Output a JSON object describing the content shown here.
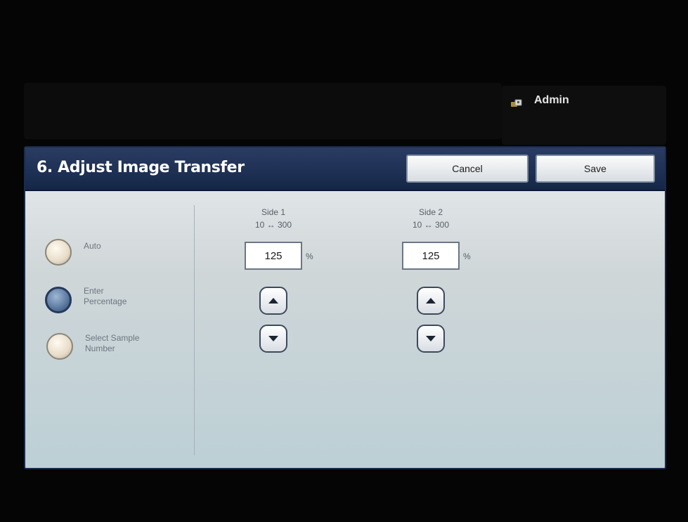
{
  "header": {
    "user_label": "Admin",
    "user_icon": "admin-key-icon"
  },
  "dialog": {
    "title": "6. Adjust Image Transfer",
    "cancel_label": "Cancel",
    "save_label": "Save"
  },
  "options": [
    {
      "label": "Auto",
      "selected": false
    },
    {
      "label": "Enter Percentage",
      "selected": true
    },
    {
      "label": "Select Sample Number",
      "selected": false
    }
  ],
  "sides": [
    {
      "title": "Side 1",
      "range": "10 ↔ 300",
      "value": "125",
      "unit": "%"
    },
    {
      "title": "Side 2",
      "range": "10 ↔ 300",
      "value": "125",
      "unit": "%"
    }
  ],
  "colors": {
    "title_bar": "#152748",
    "selected_radio": "#5f7da3",
    "panel_bg": "#c8d6da"
  }
}
